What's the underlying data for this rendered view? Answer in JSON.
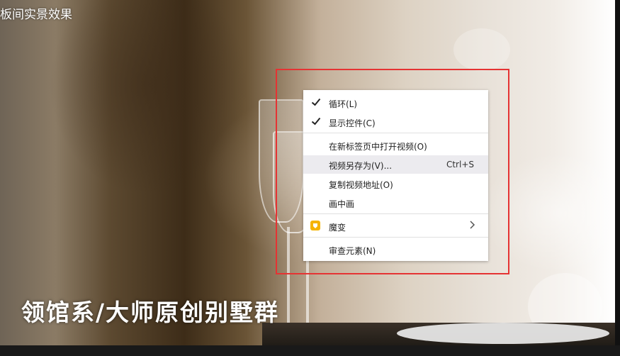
{
  "page": {
    "top_title": "板间实景效果",
    "caption": "领馆系/大师原创别墅群"
  },
  "context_menu": {
    "items": [
      {
        "label": "循环(L)",
        "checked": true
      },
      {
        "label": "显示控件(C)",
        "checked": true
      },
      {
        "label": "在新标签页中打开视频(O)"
      },
      {
        "label": "视频另存为(V)...",
        "shortcut": "Ctrl+S",
        "highlighted": true
      },
      {
        "label": "复制视频地址(O)"
      },
      {
        "label": "画中画"
      },
      {
        "label": "魔变",
        "icon": "extension-icon",
        "submenu": true
      },
      {
        "label": "审查元素(N)"
      }
    ]
  },
  "colors": {
    "highlight_box": "#e53333",
    "menu_hover": "#ecebef",
    "extension_icon": "#f5b300"
  }
}
